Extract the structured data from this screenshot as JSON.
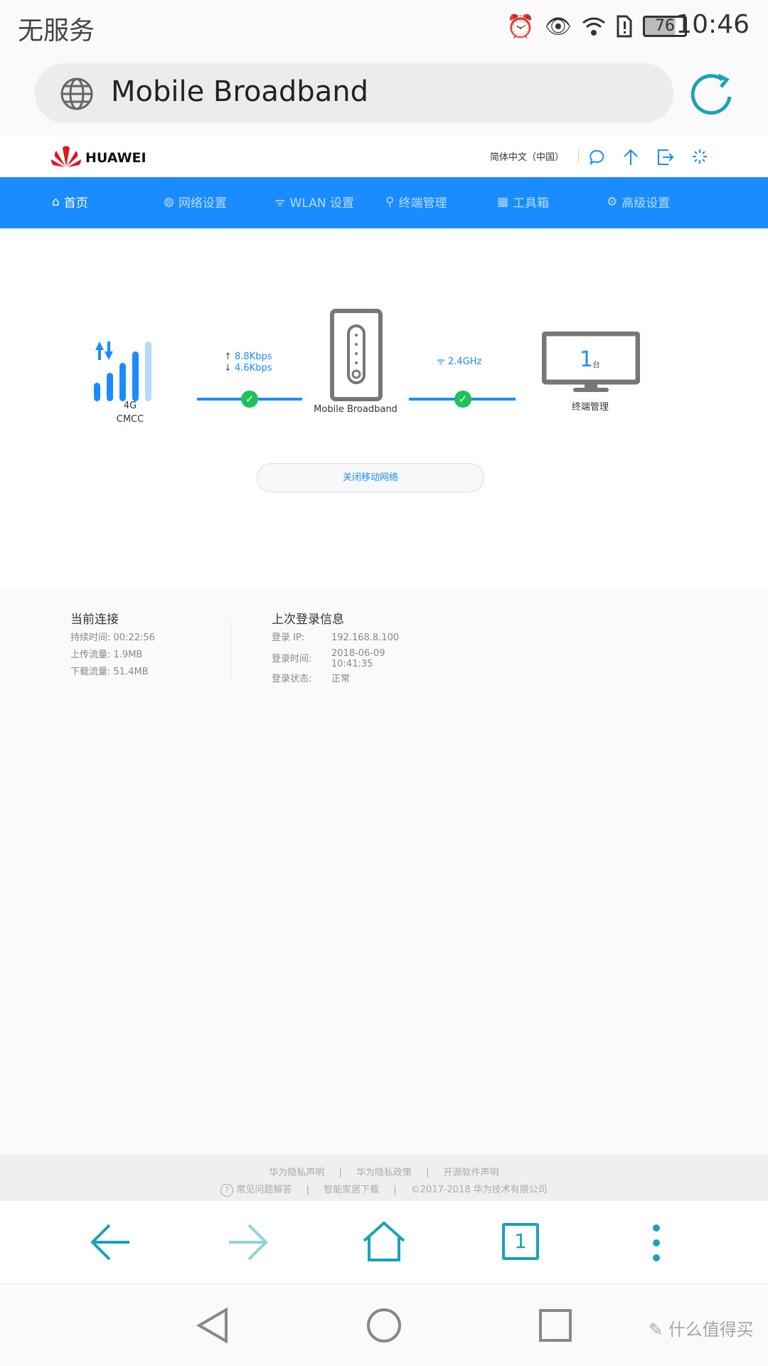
{
  "status_bar": {
    "carrier": "无服务",
    "battery": "76",
    "time": "10:46",
    "icons": [
      "alarm-icon",
      "eye-comfort-icon",
      "wifi-icon",
      "sim-alert-icon",
      "battery-icon"
    ]
  },
  "browser": {
    "url_title": "Mobile Broadband",
    "globe_icon": "globe-icon",
    "refresh_icon": "refresh-icon"
  },
  "header": {
    "brand": "HUAWEI",
    "language": "简体中文（中国）",
    "icons": [
      "message-icon",
      "upload-icon",
      "logout-icon",
      "loading-icon"
    ]
  },
  "nav": {
    "items": [
      {
        "label": "首页",
        "icon": "home-icon",
        "active": true
      },
      {
        "label": "网络设置",
        "icon": "globe-icon"
      },
      {
        "label": "WLAN 设置",
        "icon": "wifi-icon"
      },
      {
        "label": "终端管理",
        "icon": "topology-icon"
      },
      {
        "label": "工具箱",
        "icon": "toolbox-icon"
      },
      {
        "label": "高级设置",
        "icon": "gear-icon"
      }
    ]
  },
  "diagram": {
    "network_type": "4G",
    "operator": "CMCC",
    "upload_rate": "8.8Kbps",
    "download_rate": "4.6Kbps",
    "device_name": "Mobile Broadband",
    "wifi_band": "2.4GHz",
    "client_count": "1",
    "client_unit": "台",
    "clients_label": "终端管理",
    "signal_bars": 4,
    "signal_max": 5
  },
  "actions": {
    "disable_mobile": "关闭移动网络"
  },
  "current_connection": {
    "title": "当前连接",
    "duration_label": "持续时间:",
    "duration": "00:22:56",
    "upload_label": "上传流量:",
    "upload": "1.9MB",
    "download_label": "下载流量:",
    "download": "51.4MB"
  },
  "last_login": {
    "title": "上次登录信息",
    "ip_label": "登录 IP:",
    "ip": "192.168.8.100",
    "time_label": "登录时间:",
    "date": "2018-06-09",
    "time": "10:41:35",
    "status_label": "登录状态:",
    "status": "正常"
  },
  "footer": {
    "links1": [
      "华为隐私声明",
      "华为隐私政策",
      "开源软件声明"
    ],
    "faq": "常见问题解答",
    "app": "智能家居下载",
    "copyright": "©2017-2018 华为技术有限公司",
    "sep": "|"
  },
  "browser_nav": {
    "tabs_count": "1"
  },
  "watermark": "什么值得买",
  "colors": {
    "accent": "#1a8cff",
    "ok": "#1fc15a",
    "browser_icons": "#1aa3b8"
  }
}
